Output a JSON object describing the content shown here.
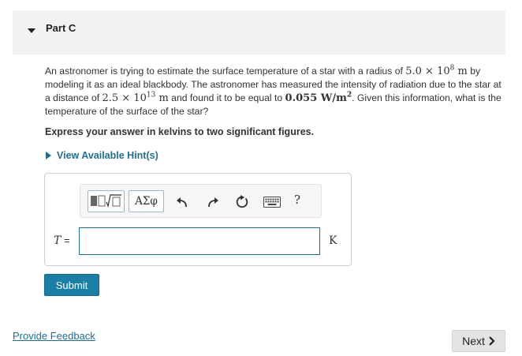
{
  "part": {
    "title": "Part C"
  },
  "question": {
    "p1": "An astronomer is trying to estimate the surface temperature of a star with a radius of ",
    "radius_coef": "5.0 × 10",
    "radius_exp": "8",
    "radius_unit": " m",
    "p2": " by modeling it as an ideal blackbody. The astronomer has measured the intensity of radiation due to the star at a distance of ",
    "dist_coef": "2.5 × 10",
    "dist_exp": "13",
    "dist_unit": " m",
    "p3": " and found it to be equal to ",
    "intensity_val": "0.055 W/m",
    "intensity_exp": "2",
    "p4": ". Given this information, what is the temperature of the surface of the star?"
  },
  "instruction": "Express your answer in kelvins to two significant figures.",
  "hint": {
    "label": "View Available Hint(s)"
  },
  "toolbar": {
    "templates_icon": "templates-icon",
    "greek_label": "ΑΣφ",
    "undo_icon": "undo-icon",
    "redo_icon": "redo-icon",
    "reset_icon": "reset-icon",
    "keyboard_icon": "keyboard-icon",
    "help_label": "?"
  },
  "answer": {
    "variable": "T",
    "equals": " =",
    "value": "",
    "placeholder": "",
    "unit": "K"
  },
  "submit_label": "Submit",
  "feedback_label": "Provide Feedback",
  "next_label": "Next",
  "colors": {
    "accent": "#1d6f93",
    "submit_bg": "#1a7fa6",
    "header_bg": "#f2f2f2"
  }
}
